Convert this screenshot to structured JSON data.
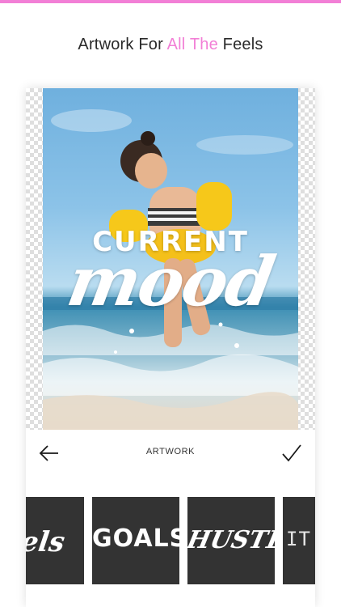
{
  "theme": {
    "accent_color": "#f27fd6",
    "tile_background": "#333333",
    "heading_color": "#2a2a2a"
  },
  "headline": {
    "prefix": "Artwork For ",
    "highlight": "All The",
    "suffix": " Feels"
  },
  "canvas": {
    "overlay_line1": "CURRENT",
    "overlay_line2": "mood"
  },
  "toolbar": {
    "back_icon": "arrow-left-icon",
    "title": "ARTWORK",
    "confirm_icon": "checkmark-icon"
  },
  "artwork_tiles": [
    {
      "label": "Feels"
    },
    {
      "label": "GOALS"
    },
    {
      "label": "HUSTLE"
    },
    {
      "label": "IT'S"
    }
  ]
}
